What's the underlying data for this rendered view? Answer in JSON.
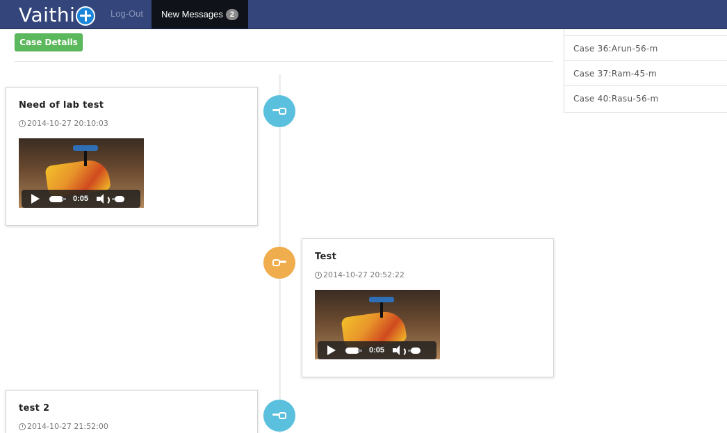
{
  "navbar": {
    "brand": "Vaithi",
    "logout_label": "Log-Out",
    "messages_label": "New Messages",
    "messages_count": "2"
  },
  "case_details_label": "Case Details",
  "cases": [
    "Case 36:Arun-56-m",
    "Case 37:Ram-45-m",
    "Case 40:Rasu-56-m"
  ],
  "timeline": [
    {
      "title": "Need of lab test",
      "time": "2014-10-27 20:10:03",
      "video_time": "0:05",
      "side": "left",
      "marker_color": "#5bc0de"
    },
    {
      "title": "Test",
      "time": "2014-10-27 20:52:22",
      "video_time": "0:05",
      "side": "right",
      "marker_color": "#f0ad4e"
    },
    {
      "title": "test 2",
      "time": "2014-10-27 21:52:00",
      "side": "left",
      "marker_color": "#5bc0de"
    }
  ],
  "colors": {
    "navbar": "#33457a",
    "case_button": "#5cb85c",
    "marker_blue": "#5bc0de",
    "marker_orange": "#f0ad4e"
  }
}
